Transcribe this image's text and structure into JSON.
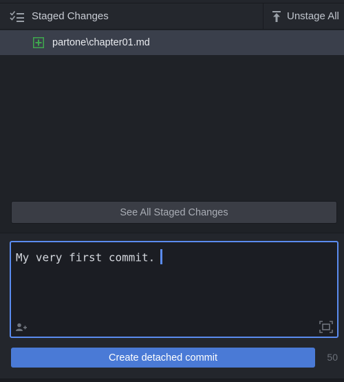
{
  "header": {
    "title": "Staged Changes",
    "title_icon": "checklist-icon",
    "unstage_all_label": "Unstage All",
    "unstage_icon": "arrow-up-to-line-icon"
  },
  "files": [
    {
      "name": "partone\\chapter01.md",
      "status_icon": "added-file-icon",
      "status_color": "#3fa84d"
    }
  ],
  "see_all_label": "See All Staged Changes",
  "commit": {
    "message": "My very first commit.",
    "button_label": "Create detached commit",
    "remaining_chars": "50",
    "accent_color": "#5b8cf0",
    "button_color": "#4a7ad6"
  }
}
